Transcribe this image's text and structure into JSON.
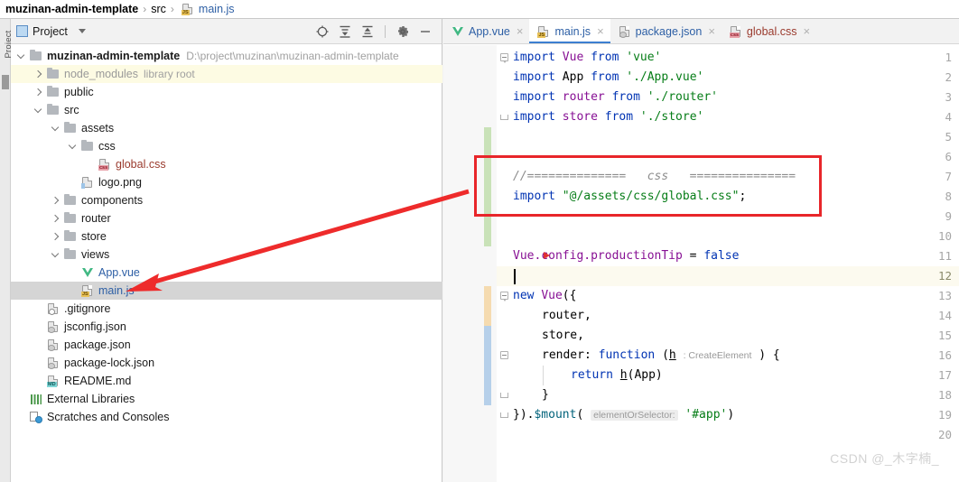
{
  "breadcrumb": {
    "project": "muzinan-admin-template",
    "folder": "src",
    "file": "main.js",
    "sep": "›"
  },
  "tool_strip": {
    "project_label": "Project"
  },
  "project_panel": {
    "title": "Project",
    "toolbar": [
      "locate-icon",
      "expand-all-icon",
      "collapse-all-icon",
      "settings-gear-icon",
      "minimize-icon"
    ],
    "tree": [
      {
        "indent": 0,
        "arrow": "down",
        "icon": "folder",
        "name": "muzinan-admin-template",
        "style": "bold",
        "suffix": "D:\\project\\muzinan\\muzinan-admin-template",
        "suffix_style": "path",
        "highlight": "none"
      },
      {
        "indent": 1,
        "arrow": "right",
        "icon": "folder",
        "name": "node_modules",
        "style": "gray",
        "suffix": "library root",
        "suffix_style": "lib",
        "highlight": "yellow"
      },
      {
        "indent": 1,
        "arrow": "right",
        "icon": "folder",
        "name": "public",
        "style": "dark",
        "suffix": "",
        "suffix_style": "",
        "highlight": "none"
      },
      {
        "indent": 1,
        "arrow": "down",
        "icon": "folder",
        "name": "src",
        "style": "dark",
        "suffix": "",
        "suffix_style": "",
        "highlight": "none"
      },
      {
        "indent": 2,
        "arrow": "down",
        "icon": "folder",
        "name": "assets",
        "style": "dark",
        "suffix": "",
        "suffix_style": "",
        "highlight": "none"
      },
      {
        "indent": 3,
        "arrow": "down",
        "icon": "folder",
        "name": "css",
        "style": "dark",
        "suffix": "",
        "suffix_style": "",
        "highlight": "none"
      },
      {
        "indent": 4,
        "arrow": "none",
        "icon": "css-file",
        "name": "global.css",
        "style": "css",
        "suffix": "",
        "suffix_style": "",
        "highlight": "none"
      },
      {
        "indent": 3,
        "arrow": "none",
        "icon": "img-file",
        "name": "logo.png",
        "style": "dark",
        "suffix": "",
        "suffix_style": "",
        "highlight": "none"
      },
      {
        "indent": 2,
        "arrow": "right",
        "icon": "folder",
        "name": "components",
        "style": "dark",
        "suffix": "",
        "suffix_style": "",
        "highlight": "none"
      },
      {
        "indent": 2,
        "arrow": "right",
        "icon": "folder",
        "name": "router",
        "style": "dark",
        "suffix": "",
        "suffix_style": "",
        "highlight": "none"
      },
      {
        "indent": 2,
        "arrow": "right",
        "icon": "folder",
        "name": "store",
        "style": "dark",
        "suffix": "",
        "suffix_style": "",
        "highlight": "none"
      },
      {
        "indent": 2,
        "arrow": "down",
        "icon": "folder",
        "name": "views",
        "style": "dark",
        "suffix": "",
        "suffix_style": "",
        "highlight": "none"
      },
      {
        "indent": 3,
        "arrow": "none",
        "icon": "vue-file",
        "name": "App.vue",
        "style": "blue",
        "suffix": "",
        "suffix_style": "",
        "highlight": "none"
      },
      {
        "indent": 3,
        "arrow": "none",
        "icon": "js-file",
        "name": "main.js",
        "style": "blue",
        "suffix": "",
        "suffix_style": "",
        "highlight": "selected"
      },
      {
        "indent": 1,
        "arrow": "none",
        "icon": "cfg-file",
        "name": ".gitignore",
        "style": "dark",
        "suffix": "",
        "suffix_style": "",
        "highlight": "none"
      },
      {
        "indent": 1,
        "arrow": "none",
        "icon": "json-file",
        "name": "jsconfig.json",
        "style": "dark",
        "suffix": "",
        "suffix_style": "",
        "highlight": "none"
      },
      {
        "indent": 1,
        "arrow": "none",
        "icon": "json-file",
        "name": "package.json",
        "style": "dark",
        "suffix": "",
        "suffix_style": "",
        "highlight": "none"
      },
      {
        "indent": 1,
        "arrow": "none",
        "icon": "json-file",
        "name": "package-lock.json",
        "style": "dark",
        "suffix": "",
        "suffix_style": "",
        "highlight": "none"
      },
      {
        "indent": 1,
        "arrow": "none",
        "icon": "md-file",
        "name": "README.md",
        "style": "dark",
        "suffix": "",
        "suffix_style": "",
        "highlight": "none"
      },
      {
        "indent": 0,
        "arrow": "none",
        "icon": "library-icon",
        "name": "External Libraries",
        "style": "dark",
        "suffix": "",
        "suffix_style": "",
        "highlight": "none"
      },
      {
        "indent": 0,
        "arrow": "none",
        "icon": "scratches-icon",
        "name": "Scratches and Consoles",
        "style": "dark",
        "suffix": "",
        "suffix_style": "",
        "highlight": "none"
      }
    ]
  },
  "editor": {
    "tabs": [
      {
        "label": "App.vue",
        "icon": "vue-file",
        "active": false,
        "close": "×"
      },
      {
        "label": "main.js",
        "icon": "js-file",
        "active": true,
        "close": "×"
      },
      {
        "label": "package.json",
        "icon": "json-file",
        "active": false,
        "close": "×"
      },
      {
        "label": "global.css",
        "icon": "css-file",
        "active": false,
        "close": "×"
      }
    ],
    "line_numbers": [
      "1",
      "2",
      "3",
      "4",
      "5",
      "6",
      "7",
      "8",
      "9",
      "10",
      "11",
      "12",
      "13",
      "14",
      "15",
      "16",
      "17",
      "18",
      "19",
      "20"
    ],
    "current_line": 12,
    "code": {
      "l1_kw1": "import",
      "l1_id": "Vue",
      "l1_kw2": "from",
      "l1_str": "'vue'",
      "l2_kw1": "import",
      "l2_id": "App",
      "l2_kw2": "from",
      "l2_str": "'./App.vue'",
      "l3_kw1": "import",
      "l3_id": "router",
      "l3_kw2": "from",
      "l3_str": "'./router'",
      "l4_kw1": "import",
      "l4_id": "store",
      "l4_kw2": "from",
      "l4_str": "'./store'",
      "l7_comment": "//==============   css   ===============",
      "l8_kw": "import",
      "l8_str": "\"@/assets/css/global.css\"",
      "l8_semi": ";",
      "l11_id": "Vue.config.productionTip",
      "l11_op": " = ",
      "l11_kw": "false",
      "l13_kw": "new",
      "l13_id": "Vue",
      "l13_punct": "({",
      "l14": "router,",
      "l15": "store,",
      "l16_prop": "render",
      "l16_colon": ": ",
      "l16_kw": "function",
      "l16_paren1": " (",
      "l16_param": "h",
      "l16_hint": ": CreateElement",
      "l16_paren2": " ) {",
      "l17_kw": "return",
      "l17_call": "h",
      "l17_arg": "(App)",
      "l18": "}",
      "l19_a": "}).",
      "l19_fn": "$mount",
      "l19_paren": "(",
      "l19_hint": "elementOrSelector:",
      "l19_str": "'#app'",
      "l19_close": ")"
    }
  },
  "annotations": {
    "red_box_color": "#e8262a",
    "arrow_color": "#ee2b2b"
  },
  "watermark": {
    "text": "CSDN @_木字楠_"
  }
}
